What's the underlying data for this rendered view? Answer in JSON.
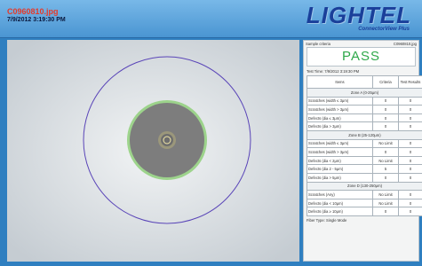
{
  "header": {
    "filename": "C0960810.jpg",
    "timestamp": "7/9/2012 3:19:30 PM",
    "logo": "LIGHTEL",
    "product": "ConnectorView Plus"
  },
  "panel": {
    "criteria_label": "Sample criteria",
    "file_label": "C0960810.jpg",
    "result": "PASS",
    "test_time": "Test Time: 7/9/2012 3:19:30 PM",
    "columns": [
      "Items",
      "Criteria",
      "Test Results"
    ],
    "zones": [
      {
        "title": "Zone A (0-25μm)",
        "rows": [
          [
            "Scratches (width ≤ 3μm)",
            "0",
            "0"
          ],
          [
            "Scratches (width > 3μm)",
            "0",
            "0"
          ],
          [
            "Defects (dia ≤ 3μm)",
            "0",
            "0"
          ],
          [
            "Defects (dia > 3μm)",
            "0",
            "0"
          ]
        ]
      },
      {
        "title": "Zone B (25-120μm)",
        "rows": [
          [
            "Scratches (width ≤ 3μm)",
            "No Limit",
            "0"
          ],
          [
            "Scratches (width > 3μm)",
            "0",
            "0"
          ],
          [
            "Defects (dia < 2μm)",
            "No Limit",
            "0"
          ],
          [
            "Defects (dia 2 - 5μm)",
            "5",
            "0"
          ],
          [
            "Defects (dia > 5μm)",
            "0",
            "0"
          ]
        ]
      },
      {
        "title": "Zone D (130-250μm)",
        "rows": [
          [
            "Scratches (Any)",
            "No Limit",
            "0"
          ],
          [
            "Defects (dia < 10μm)",
            "No Limit",
            "0"
          ],
          [
            "Defects (dia ≥ 10μm)",
            "0",
            "0"
          ]
        ]
      }
    ],
    "fiber_type": "Fiber Type: Single Mode"
  },
  "colors": {
    "pass": "#2ea84a",
    "filename": "#e53a2a",
    "logo": "#1a3f9a",
    "zone_ring": "#5a45b8",
    "cladding_ring": "#8fcf7a"
  }
}
